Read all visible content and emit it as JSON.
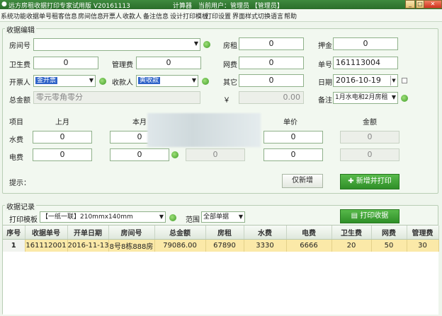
{
  "window": {
    "title": "远方房租收据打印专家试用版 V20161113",
    "calc": "计算器",
    "current_user": "当前用户：管理员 【管理员】",
    "btn_min": "_",
    "btn_max": "□",
    "btn_close": "✕"
  },
  "menu": [
    "系统功能",
    "收据单号",
    "租客信息",
    "房间信息",
    "开票人",
    "收款人",
    "备注信息",
    "设计打印模板",
    "打印设置",
    "界面样式",
    "切换语言",
    "帮助"
  ],
  "edit": {
    "group_title": "收据编辑",
    "room_no": {
      "label": "房间号",
      "value": ""
    },
    "rent": {
      "label": "房租",
      "value": "0"
    },
    "deposit": {
      "label": "押金",
      "value": "0"
    },
    "sanitation": {
      "label": "卫生费",
      "value": "0"
    },
    "management": {
      "label": "管理费",
      "value": "0"
    },
    "network": {
      "label": "网费",
      "value": "0"
    },
    "receipt_no": {
      "label": "单号",
      "value": "161113004"
    },
    "issuer": {
      "label": "开票人",
      "value": "金开票"
    },
    "payee": {
      "label": "收款人",
      "value": "黄收款"
    },
    "other": {
      "label": "其它",
      "value": "0"
    },
    "date": {
      "label": "日期",
      "value": "2016-10-19"
    },
    "total": {
      "label": "总金额",
      "placeholder": "零元零角零分",
      "currency": "￥",
      "amount": "0.00"
    },
    "remark": {
      "label": "备注",
      "value": "1月水电和2月房租"
    },
    "utility_headers": {
      "item": "项目",
      "last": "上月",
      "this": "本月",
      "price": "单价",
      "amount": "金额"
    },
    "water": {
      "label": "水费",
      "last": "0",
      "this": "0",
      "price": "0",
      "amount": "0"
    },
    "electric": {
      "label": "电费",
      "last": "0",
      "this": "0",
      "usage": "0",
      "price": "0",
      "amount": "0"
    },
    "hint_label": "提示：",
    "only_add_button": "仅新增",
    "add_print_button": "新增并打印"
  },
  "records": {
    "group_title": "收据记录",
    "template_label": "打印模板",
    "template_value": "【一纸一联】210mmx140mm",
    "range_label": "范围",
    "range_value": "全部单据",
    "print_button": "打印收据",
    "columns": [
      "序号",
      "收据单号",
      "开单日期",
      "房间号",
      "总金额",
      "房租",
      "水费",
      "电费",
      "卫生费",
      "网费",
      "管理费"
    ],
    "rows": [
      [
        "1",
        "161112001",
        "2016-11-13",
        "8号8栋888房",
        "79086.00",
        "67890",
        "3330",
        "6666",
        "20",
        "50",
        "30"
      ]
    ]
  },
  "colors": {
    "title_green": "#2f7a2f",
    "accent_green": "#3c9b24",
    "selection_blue": "#2f63c8",
    "row_highlight": "#fbe9a8"
  }
}
